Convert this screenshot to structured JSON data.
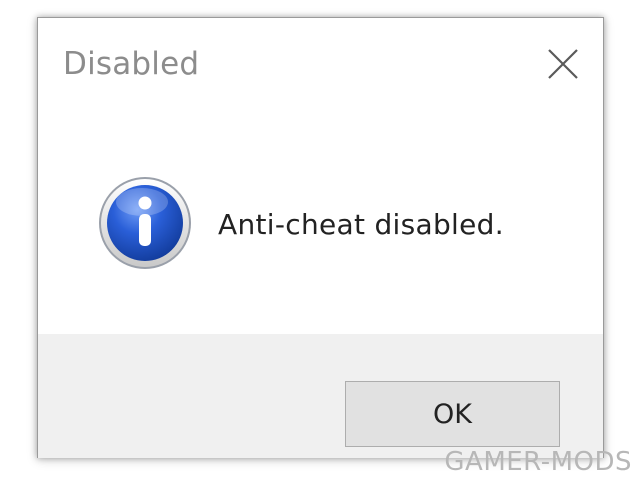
{
  "dialog": {
    "title": "Disabled",
    "close_icon": "close-icon",
    "message": "Anti-cheat disabled.",
    "message_icon": "info-icon",
    "ok_label": "OK"
  },
  "watermark": {
    "text": "GAMER-MODS"
  },
  "colors": {
    "title_text": "#8c8c8c",
    "footer_bg": "#f0f0f0",
    "button_bg": "#e1e1e1",
    "icon_blue": "#1c4ec9"
  }
}
